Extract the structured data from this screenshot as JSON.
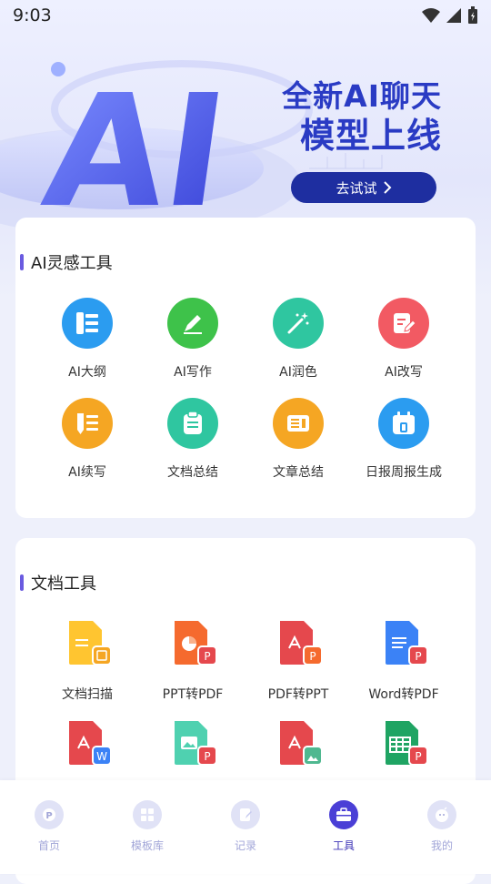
{
  "status": {
    "time": "9:03"
  },
  "banner": {
    "title_line1": "全新AI聊天",
    "title_line2": "模型上线",
    "button_label": "去试试",
    "hero_text": "AI"
  },
  "ai_tools": {
    "heading": "AI灵感工具",
    "items": [
      {
        "label": "AI大纲",
        "icon": "outline-icon",
        "color": "#2b9cf0"
      },
      {
        "label": "AI写作",
        "icon": "pen-icon",
        "color": "#3ec24a"
      },
      {
        "label": "AI润色",
        "icon": "magic-wand-icon",
        "color": "#2fc6a0"
      },
      {
        "label": "AI改写",
        "icon": "edit-doc-icon",
        "color": "#f25a63"
      },
      {
        "label": "AI续写",
        "icon": "continue-write-icon",
        "color": "#f5a623"
      },
      {
        "label": "文档总结",
        "icon": "clipboard-icon",
        "color": "#2fc6a0"
      },
      {
        "label": "文章总结",
        "icon": "article-icon",
        "color": "#f5a623"
      },
      {
        "label": "日报周报生成",
        "icon": "calendar-icon",
        "color": "#2b9cf0"
      }
    ]
  },
  "doc_tools": {
    "heading": "文档工具",
    "items": [
      {
        "label": "文档扫描",
        "icon": "scan-doc-icon"
      },
      {
        "label": "PPT转PDF",
        "icon": "ppt-to-pdf-icon"
      },
      {
        "label": "PDF转PPT",
        "icon": "pdf-to-ppt-icon"
      },
      {
        "label": "Word转PDF",
        "icon": "word-to-pdf-icon"
      },
      {
        "label": "",
        "icon": "pdf-to-word-icon"
      },
      {
        "label": "",
        "icon": "image-to-pdf-icon"
      },
      {
        "label": "",
        "icon": "pdf-to-image-icon"
      },
      {
        "label": "",
        "icon": "excel-to-pdf-icon"
      }
    ]
  },
  "nav": {
    "items": [
      {
        "label": "首页",
        "icon": "home-icon"
      },
      {
        "label": "模板库",
        "icon": "template-icon"
      },
      {
        "label": "记录",
        "icon": "record-icon"
      },
      {
        "label": "工具",
        "icon": "toolbox-icon",
        "active": true
      },
      {
        "label": "我的",
        "icon": "profile-icon"
      }
    ]
  }
}
